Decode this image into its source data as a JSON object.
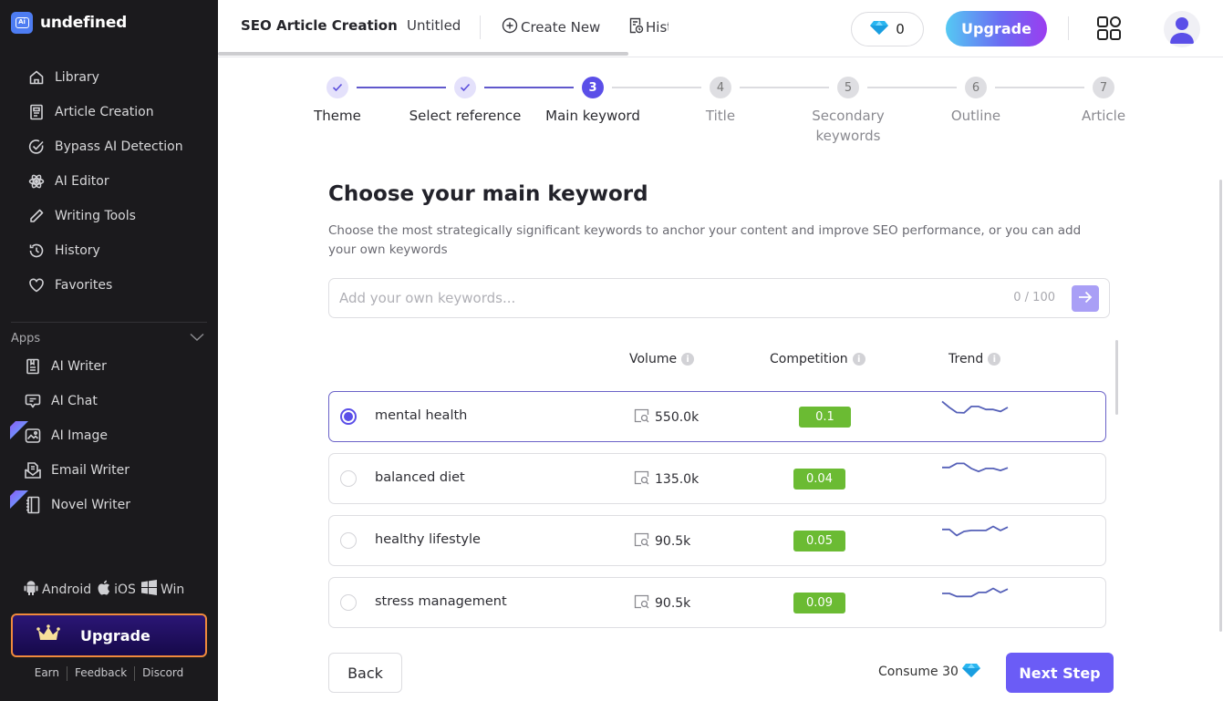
{
  "brand": {
    "name": "undefined",
    "logo_text": "Ai"
  },
  "sidebar": {
    "nav": [
      {
        "label": "Library",
        "icon": "home-icon"
      },
      {
        "label": "Article Creation",
        "icon": "document-icon"
      },
      {
        "label": "Bypass AI Detection",
        "icon": "check-circle-icon"
      },
      {
        "label": "AI Editor",
        "icon": "atom-icon"
      },
      {
        "label": "Writing Tools",
        "icon": "pencil-icon"
      },
      {
        "label": "History",
        "icon": "history-icon"
      },
      {
        "label": "Favorites",
        "icon": "heart-icon"
      }
    ],
    "apps_label": "Apps",
    "apps": [
      {
        "label": "AI Writer",
        "icon": "notebook-icon",
        "new": false
      },
      {
        "label": "AI Chat",
        "icon": "chat-icon",
        "new": false
      },
      {
        "label": "AI Image",
        "icon": "image-icon",
        "new": true
      },
      {
        "label": "Email Writer",
        "icon": "mail-icon",
        "new": false
      },
      {
        "label": "Novel Writer",
        "icon": "book-icon",
        "new": true
      }
    ],
    "platforms": [
      {
        "label": "Android",
        "icon": "android-icon"
      },
      {
        "label": "iOS",
        "icon": "apple-icon"
      },
      {
        "label": "Win",
        "icon": "windows-icon"
      }
    ],
    "upgrade_label": "Upgrade",
    "footer_links": [
      "Earn",
      "Feedback",
      "Discord"
    ]
  },
  "header": {
    "title": "SEO Article Creation",
    "doc_name": "Untitled",
    "create_new": "Create New",
    "history": "History",
    "gems": "0",
    "upgrade": "Upgrade"
  },
  "steps": [
    {
      "num": "1",
      "label": "Theme",
      "state": "done"
    },
    {
      "num": "2",
      "label": "Select reference",
      "state": "done"
    },
    {
      "num": "3",
      "label": "Main keyword",
      "state": "active"
    },
    {
      "num": "4",
      "label": "Title",
      "state": "todo"
    },
    {
      "num": "5",
      "label": "Secondary keywords",
      "state": "todo"
    },
    {
      "num": "6",
      "label": "Outline",
      "state": "todo"
    },
    {
      "num": "7",
      "label": "Article",
      "state": "todo"
    }
  ],
  "main": {
    "heading": "Choose your main keyword",
    "description": "Choose the most strategically significant keywords to anchor your content and improve SEO performance, or you can add your own keywords",
    "input_placeholder": "Add your own keywords...",
    "input_value": "",
    "input_count": "0 / 100",
    "columns": {
      "volume": "Volume",
      "competition": "Competition",
      "trend": "Trend"
    },
    "keywords": [
      {
        "keyword": "mental health",
        "volume": "550.0k",
        "competition": "0.1",
        "selected": true,
        "trend": [
          8,
          5,
          2.5,
          2.3,
          5.5,
          5.5,
          4,
          4,
          3,
          5
        ]
      },
      {
        "keyword": "balanced diet",
        "volume": "135.0k",
        "competition": "0.04",
        "selected": false,
        "trend": [
          6,
          6,
          8,
          8,
          5.5,
          4,
          5.5,
          5.5,
          4.5,
          5.8
        ]
      },
      {
        "keyword": "healthy lifestyle",
        "volume": "90.5k",
        "competition": "0.05",
        "selected": false,
        "trend": [
          6,
          6,
          3,
          5,
          5.5,
          5.5,
          5.5,
          7.5,
          5.5,
          7.2
        ]
      },
      {
        "keyword": "stress management",
        "volume": "90.5k",
        "competition": "0.09",
        "selected": false,
        "trend": [
          5,
          5,
          3.5,
          3.5,
          3.5,
          5.5,
          5.5,
          7.5,
          5.5,
          7.2
        ]
      }
    ]
  },
  "footer": {
    "back": "Back",
    "consume": "Consume 30",
    "next": "Next Step"
  },
  "colors": {
    "accent": "#5b4fe8",
    "competition_bg": "#6bbb33",
    "trend_line": "#5560b8",
    "sidebar_bg": "#1b1a1d"
  }
}
